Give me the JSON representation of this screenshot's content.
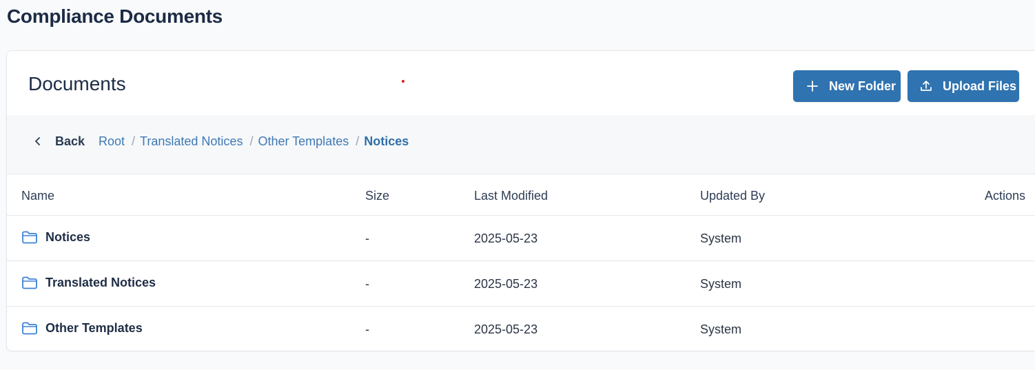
{
  "page": {
    "title": "Compliance Documents"
  },
  "card": {
    "title": "Documents",
    "buttons": {
      "new_folder": "New Folder",
      "upload_files": "Upload Files"
    }
  },
  "breadcrumb": {
    "back_label": "Back",
    "items": [
      "Root",
      "Translated Notices",
      "Other Templates"
    ],
    "separator": "/",
    "current": "Notices"
  },
  "table": {
    "columns": {
      "name": "Name",
      "size": "Size",
      "modified": "Last Modified",
      "updated_by": "Updated By",
      "actions": "Actions"
    },
    "rows": [
      {
        "name": "Notices",
        "size": "-",
        "modified": "2025-05-23",
        "updated_by": "System",
        "icon": "folder-icon"
      },
      {
        "name": "Translated Notices",
        "size": "-",
        "modified": "2025-05-23",
        "updated_by": "System",
        "icon": "folder-icon"
      },
      {
        "name": "Other Templates",
        "size": "-",
        "modified": "2025-05-23",
        "updated_by": "System",
        "icon": "folder-icon"
      }
    ]
  },
  "colors": {
    "primary_button": "#2f73b0",
    "link": "#3f78b4",
    "folder_icon": "#3b82d6",
    "title_text": "#1c2b45"
  }
}
